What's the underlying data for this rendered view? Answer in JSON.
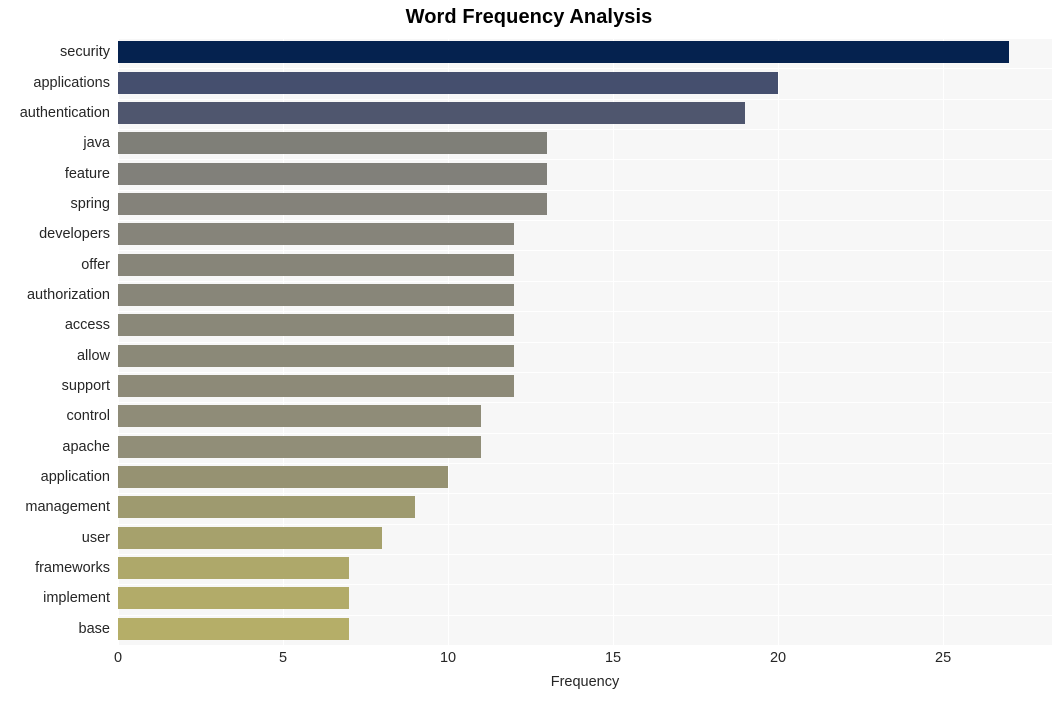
{
  "chart_data": {
    "type": "bar",
    "orientation": "horizontal",
    "title": "Word Frequency Analysis",
    "xlabel": "Frequency",
    "ylabel": "",
    "xlim": [
      0,
      28.3
    ],
    "xticks": [
      0,
      5,
      10,
      15,
      20,
      25
    ],
    "xtick_labels": [
      "0",
      "5",
      "10",
      "15",
      "20",
      "25"
    ],
    "grid": true,
    "legend": "none",
    "background": "#f7f7f7",
    "gridline_color": "#ffffff",
    "categories": [
      "security",
      "applications",
      "authentication",
      "java",
      "feature",
      "spring",
      "developers",
      "offer",
      "authorization",
      "access",
      "allow",
      "support",
      "control",
      "apache",
      "application",
      "management",
      "user",
      "frameworks",
      "implement",
      "base"
    ],
    "values": [
      27,
      20,
      19,
      13,
      13,
      13,
      12,
      12,
      12,
      12,
      12,
      12,
      11,
      11,
      10,
      9,
      8,
      7,
      7,
      7
    ],
    "bar_colors": [
      "#05224f",
      "#454f6e",
      "#4f566e",
      "#7f7f78",
      "#81807a",
      "#84827a",
      "#86847a",
      "#878579",
      "#888679",
      "#8a8879",
      "#8b8978",
      "#8d8a78",
      "#8f8c78",
      "#918e78",
      "#969272",
      "#9e9a6f",
      "#a6a16c",
      "#aea86a",
      "#b2ab69",
      "#b5ae68"
    ]
  }
}
